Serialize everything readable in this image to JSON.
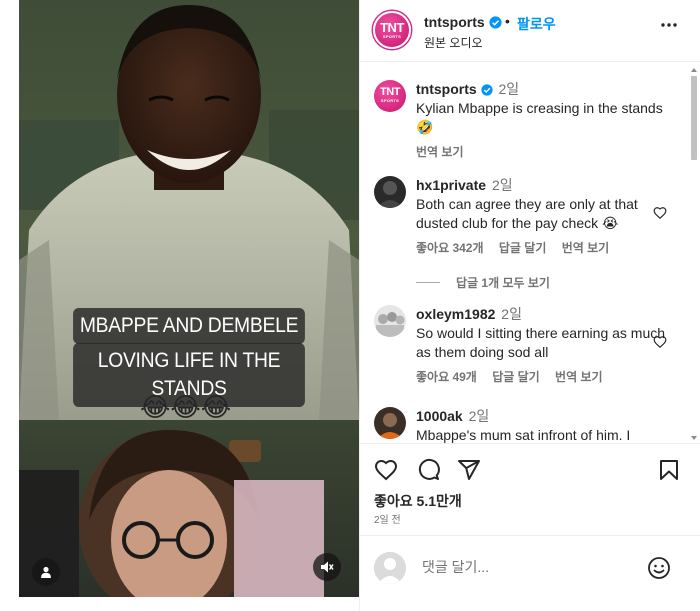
{
  "video": {
    "caption_line1": "MBAPPE AND DEMBELE",
    "caption_line2": "LOVING LIFE IN THE STANDS",
    "emojis": "😂😂😂",
    "user_tag_icon": "person-icon",
    "mute_icon": "speaker-muted-icon"
  },
  "header": {
    "avatar_text": "TNT",
    "avatar_subtext": "SPORTS",
    "username": "tntsports",
    "separator": "•",
    "follow_label": "팔로우",
    "audio_label": "원본 오디오",
    "more_icon": "more-horizontal-icon"
  },
  "caption_post": {
    "username": "tntsports",
    "age": "2일",
    "text": "Kylian Mbappe is creasing in the stands",
    "emoji": "🤣",
    "translate": "번역 보기"
  },
  "comments": [
    {
      "username": "hx1private",
      "age": "2일",
      "text": "Both can agree they are only at that dusted club for the pay check",
      "emoji": "😭",
      "likes": "좋아요 342개",
      "reply": "답글 달기",
      "translate": "번역 보기"
    },
    {
      "username": "oxleym1982",
      "age": "2일",
      "text": "So would I sitting there earning as much as them doing sod all",
      "likes": "좋아요 49개",
      "reply": "답글 달기",
      "translate": "번역 보기"
    },
    {
      "username": "1000ak",
      "age": "2일",
      "text": "Mbappe's mum sat infront of him. I"
    }
  ],
  "view_replies": "답글 1개 모두 보기",
  "actions": {
    "like_icon": "heart-icon",
    "comment_icon": "comment-icon",
    "share_icon": "send-icon",
    "save_icon": "bookmark-icon",
    "likes_text": "좋아요 5.1만개",
    "time_text": "2일 전"
  },
  "comment_input": {
    "placeholder": "댓글 달기...",
    "emoji_icon": "smiley-icon"
  },
  "colors": {
    "brand_pink": "#d62e88",
    "link_blue": "#0095f6",
    "verified_blue": "#0095f6"
  }
}
